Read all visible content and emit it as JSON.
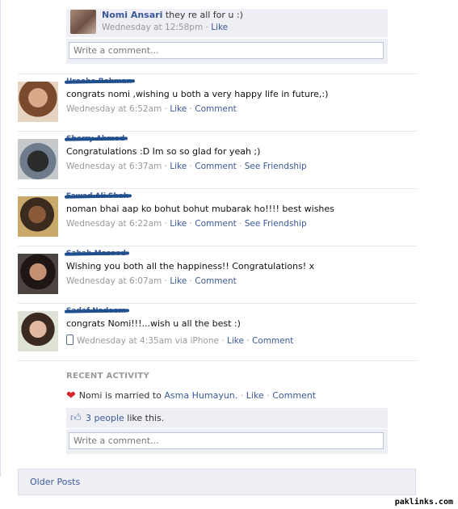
{
  "top_comment": {
    "author": "Nomi Ansari",
    "text": "they re all for u :)",
    "time": "Wednesday at 12:58pm",
    "like": "Like"
  },
  "write_comment_placeholder": "Write a comment...",
  "posts": [
    {
      "name": "Urooba Rahman",
      "message": "congrats nomi ,wishing u both a very happy life in future,:)",
      "time": "Wednesday at 6:52am",
      "actions": [
        "Like",
        "Comment"
      ]
    },
    {
      "name": "Sherry Ahmed",
      "message": "Congratulations :D Im so so glad for yeah ;)",
      "time": "Wednesday at 6:37am",
      "actions": [
        "Like",
        "Comment",
        "See Friendship"
      ]
    },
    {
      "name": "Fawad Ali Shah",
      "message": "noman bhai aap ko bohut bohut mubarak ho!!!! best wishes",
      "time": "Wednesday at 6:22am",
      "actions": [
        "Like",
        "Comment",
        "See Friendship"
      ]
    },
    {
      "name": "Sabah Masood",
      "message": "Wishing you both all the happiness!! Congratulations! x",
      "time": "Wednesday at 6:07am",
      "actions": [
        "Like",
        "Comment"
      ]
    },
    {
      "name": "Sadaf Nadeem",
      "message": "congrats Nomi!!!...wish u all the best :)",
      "time": "Wednesday at 4:35am via iPhone",
      "actions": [
        "Like",
        "Comment"
      ]
    }
  ],
  "recent_activity": {
    "title": "RECENT ACTIVITY",
    "prefix": "Nomi is married to",
    "spouse": "Asma Humayun.",
    "like": "Like",
    "comment": "Comment",
    "likes_link": "3 people",
    "likes_suffix": "like this."
  },
  "older_posts": "Older Posts",
  "watermark": "paklinks.com",
  "colors": {
    "link": "#3b5998",
    "meta": "#999999",
    "box_bg": "#edeff4",
    "heart": "#d8232a"
  },
  "icons": {
    "heart": "heart-icon",
    "thumbs_up": "thumbs-up-icon",
    "phone": "mobile-phone-icon"
  }
}
